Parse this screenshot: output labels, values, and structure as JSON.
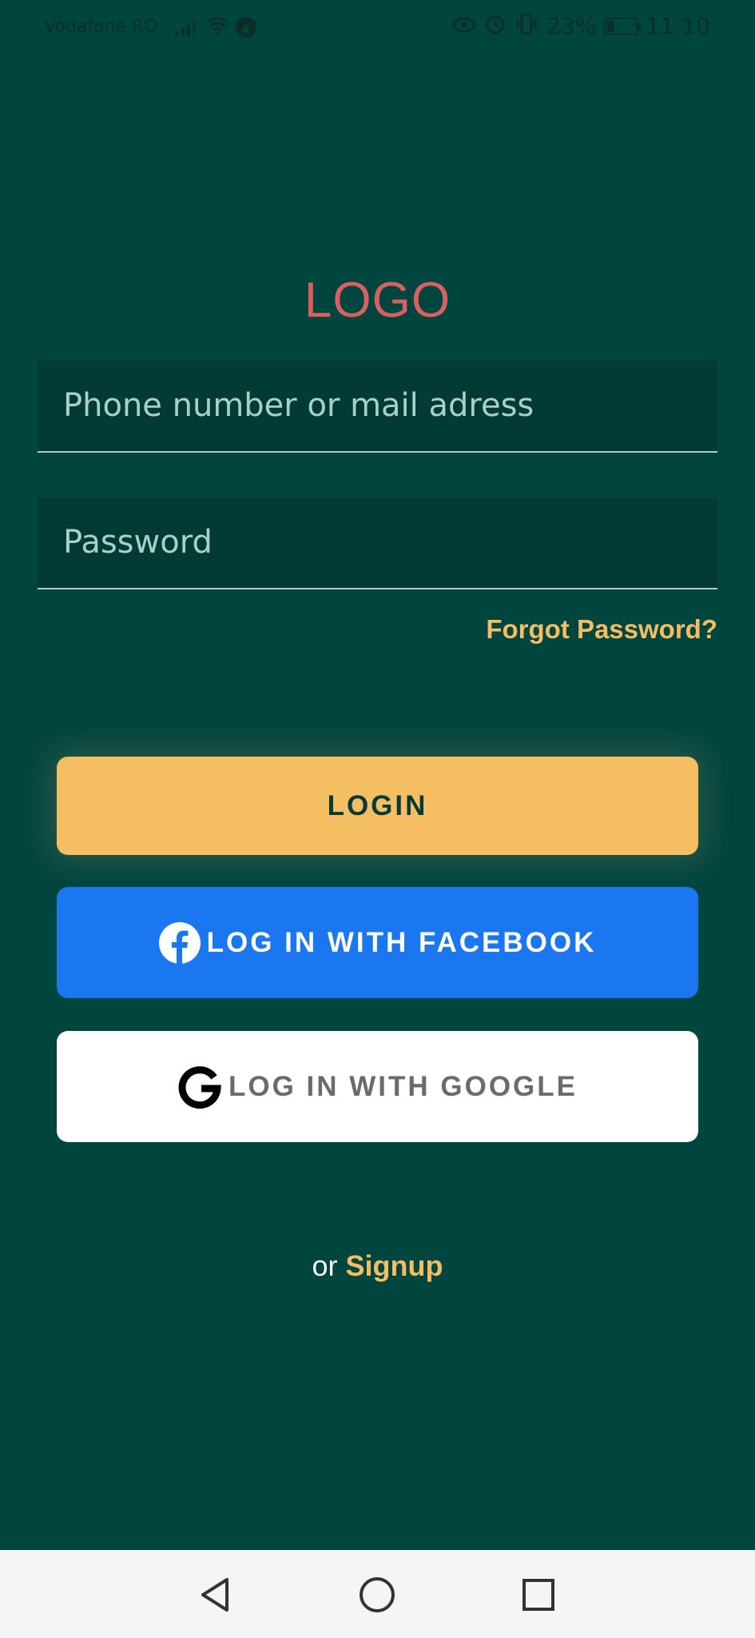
{
  "status_bar": {
    "carrier": "Vodafone RO",
    "battery_percent": "23%",
    "battery_level": 0.23,
    "time": "11:10",
    "icons": [
      "signal-icon",
      "wifi-icon",
      "app-notification-icon",
      "eye-icon",
      "alarm-icon",
      "vibrate-icon",
      "battery-icon"
    ]
  },
  "logo": {
    "text": "LOGO",
    "color": "#d9605e"
  },
  "form": {
    "identifier_placeholder": "Phone number or mail adress",
    "identifier_value": "",
    "password_placeholder": "Password",
    "password_value": "",
    "forgot_label": "Forgot Password?"
  },
  "buttons": {
    "login_label": "LOGIN",
    "facebook_label": "LOG IN WITH FACEBOOK",
    "google_label": "LOG IN WITH GOOGLE"
  },
  "signup": {
    "prefix": "or",
    "link_label": "Signup"
  },
  "colors": {
    "background": "#01453f",
    "accent": "#f6be63",
    "facebook": "#1b77f0",
    "google_bg": "#ffffff"
  },
  "navigation_bar": {
    "icons": [
      "back-icon",
      "home-icon",
      "recents-icon"
    ]
  }
}
